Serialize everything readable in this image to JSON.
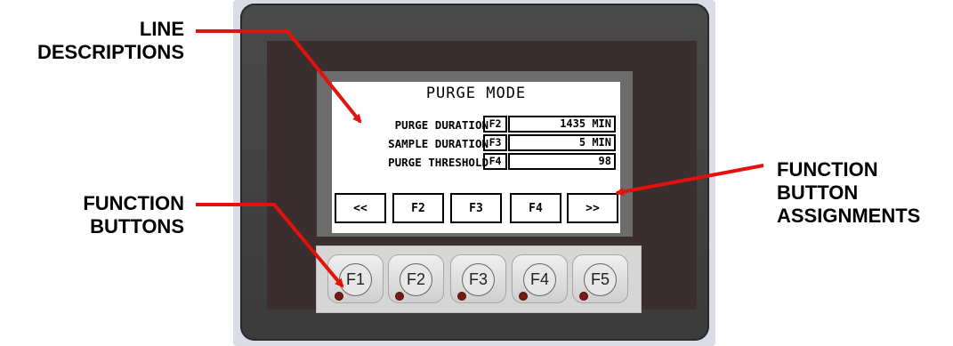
{
  "callouts": {
    "line_descriptions": [
      "LINE",
      "DESCRIPTIONS"
    ],
    "function_buttons": [
      "FUNCTION",
      "BUTTONS"
    ],
    "function_button_assignments": [
      "FUNCTION",
      "BUTTON",
      "ASSIGNMENTS"
    ]
  },
  "screen": {
    "title": "PURGE MODE",
    "rows": [
      {
        "label": "PURGE DURATION",
        "key": "F2",
        "value": "1435 MIN"
      },
      {
        "label": "SAMPLE DURATION",
        "key": "F3",
        "value": "5 MIN"
      },
      {
        "label": "PURGE THRESHOLD",
        "key": "F4",
        "value": "98"
      }
    ],
    "soft_buttons": [
      "<<",
      "F2",
      "F3",
      "F4",
      ">>"
    ]
  },
  "keypad": {
    "keys": [
      "F1",
      "F2",
      "F3",
      "F4",
      "F5"
    ]
  },
  "colors": {
    "arrow": "#e3120b",
    "led": "#7b1a14",
    "bezel": "#3b3b3b"
  }
}
